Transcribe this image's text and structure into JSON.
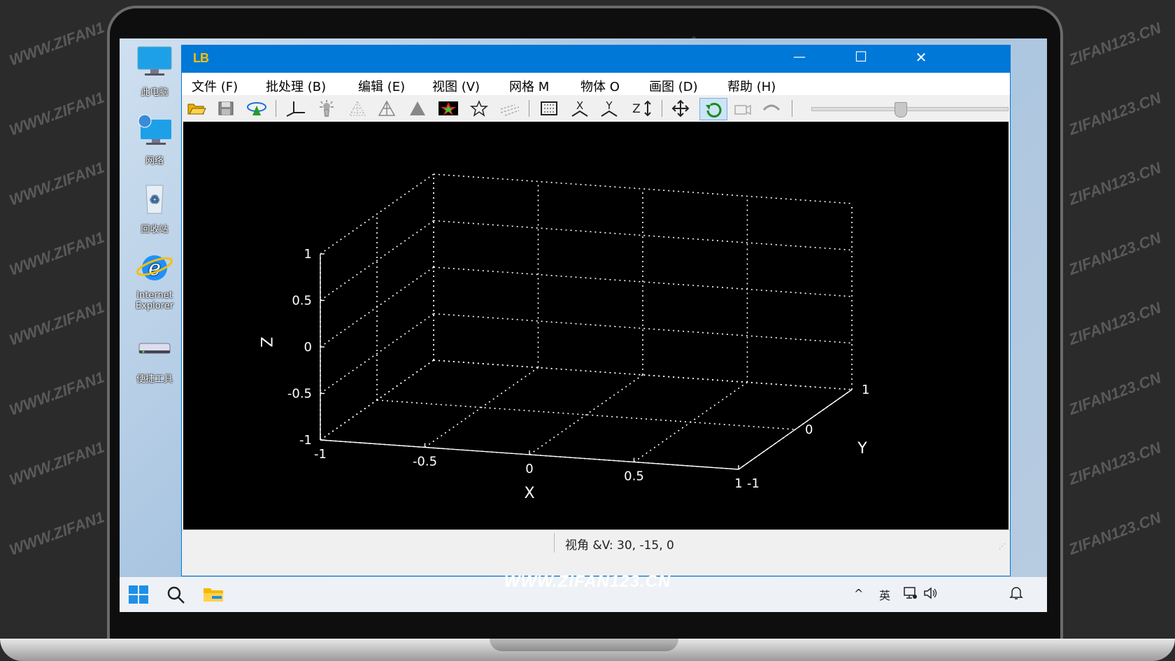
{
  "watermarks": {
    "left": "WWW.ZIFAN1",
    "right": "ZIFAN123.CN",
    "bottom": "WWW.ZIFAN123.CN"
  },
  "desktop": {
    "icons": [
      {
        "label": "此电脑",
        "icon": "computer-icon"
      },
      {
        "label": "网络",
        "icon": "network-icon"
      },
      {
        "label": "回收站",
        "icon": "recycle-bin-icon"
      },
      {
        "label": "Internet Explorer",
        "icon": "ie-icon"
      },
      {
        "label": "便捷工具",
        "icon": "drive-icon"
      }
    ]
  },
  "window": {
    "logo": "LB",
    "controls": {
      "minimize": "—",
      "maximize": "☐",
      "close": "✕"
    },
    "menu": [
      "文件 (F)",
      "批处理 (B)",
      "编辑 (E)",
      "视图 (V)",
      "网格 M",
      "物体 O",
      "画图 (D)",
      "帮助 (H)"
    ],
    "status": "视角 &V: 30, -15, 0"
  },
  "chart_data": {
    "type": "3d-axes",
    "x_ticks": [
      "-1",
      "-0.5",
      "0",
      "0.5",
      "1"
    ],
    "y_ticks": [
      "-1",
      "0",
      "1"
    ],
    "z_ticks": [
      "-1",
      "-0.5",
      "0",
      "0.5",
      "1"
    ],
    "xlabel": "X",
    "ylabel": "Y",
    "zlabel": "Z",
    "xlim": [
      -1,
      1
    ],
    "ylim": [
      -1,
      1
    ],
    "zlim": [
      -1,
      1
    ],
    "view_azimuth": 30,
    "view_elevation": -15,
    "grid": true,
    "background": "#000000",
    "axis_color": "#ffffff"
  },
  "taskbar": {
    "tray": {
      "chevron": "^",
      "ime": "英"
    }
  }
}
